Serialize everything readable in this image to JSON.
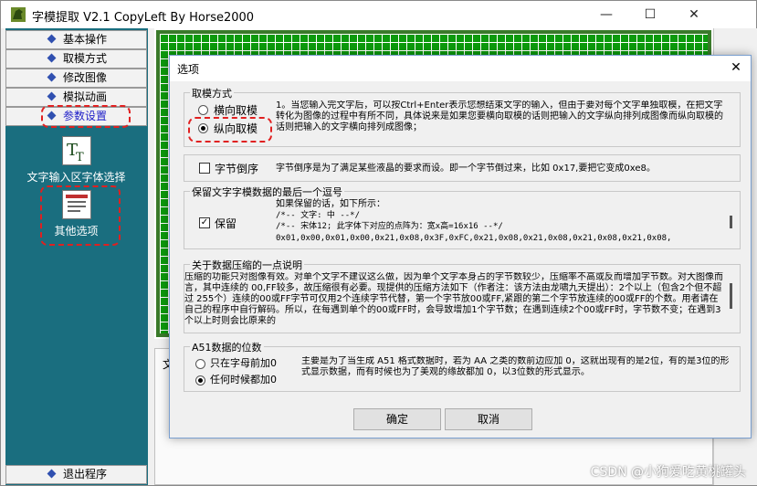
{
  "window": {
    "title": "字模提取 V2.1  CopyLeft By Horse2000",
    "min_glyph": "—",
    "max_glyph": "☐",
    "close_glyph": "✕"
  },
  "sidebar": {
    "items": [
      {
        "label": "基本操作"
      },
      {
        "label": "取模方式"
      },
      {
        "label": "修改图像"
      },
      {
        "label": "模拟动画"
      },
      {
        "label": "参数设置"
      }
    ],
    "tools": [
      {
        "label": "文字输入区字体选择"
      },
      {
        "label": "其他选项"
      }
    ],
    "exit_label": "退出程序"
  },
  "dialog": {
    "title": "选项",
    "close_glyph": "✕",
    "mode": {
      "caption": "取模方式",
      "options": [
        "横向取模",
        "纵向取模"
      ],
      "selected": "纵向取模",
      "description": "1。当您输入完文字后，可以按Ctrl+Enter表示您想结束文字的输入，但由于要对每个文字单独取模，在把文字转化为图像的过程中有所不同，具体说来是如果您要横向取模的话则把输入的文字纵向排列成图像而纵向取模的话则把输入的文字横向排列成图像；"
    },
    "byte_reverse": {
      "label": "字节倒序",
      "checked": false,
      "description": "字节倒序是为了满足某些液晶的要求而设。即一个字节倒过来，比如 0x17,要把它变成0xe8。"
    },
    "comma": {
      "caption": "保留文字字模数据的最后一个逗号",
      "label": "保留",
      "checked": true,
      "lines": [
        "如果保留的话，如下所示：",
        "/*--  文字:  中  --*/",
        "/*--  宋体12;  此字体下对应的点阵为：宽x高=16x16   --*/",
        "0x01,0x00,0x01,0x00,0x21,0x08,0x3F,0xFC,0x21,0x08,0x21,0x08,0x21,0x08,0x21,0x08,"
      ]
    },
    "compress": {
      "caption": "关于数据压缩的一点说明",
      "text": "压缩的功能只对图像有效。对单个文字不建议这么做，因为单个文字本身占的字节数较少，压缩率不高或反而增加字节数。对大图像而言，其中连续的 00,FF较多，故压缩很有必要。现提供的压缩方法如下（作者注：该方法由龙啸九天提出）：2个以上（包含2个但不超过 255个）连续的00或FF字节可仅用2个连续字节代替，第一个字节放00或FF,紧跟的第二个字节放连续的00或FF的个数。用者请在自己的程序中自行解码。所以，在每遇到单个的00或FF时，会导致增加1个字节数；在遇到连续2个00或FF时，字节数不变；在遇到3个以上时则会比原来的"
    },
    "a51": {
      "caption": "A51数据的位数",
      "options": [
        "只在字母前加0",
        "任何时候都加0"
      ],
      "selected": "任何时候都加0",
      "description": "主要是为了当生成 A51 格式数据时，若为 AA 之类的数前边应加 0，这就出现有的是2位，有的是3位的形式显示数据，而有时候也为了美观的缘故都加 0，以3位数的形式显示。"
    },
    "ok_label": "确定",
    "cancel_label": "取消"
  },
  "lower_panel_fragment": "文",
  "watermark": "CSDN @小狗爱吃黄桃罐头",
  "colors": {
    "panel": "#1a6e7f",
    "grid_green": "#0c9a0c",
    "annotation_red": "#e02020"
  }
}
